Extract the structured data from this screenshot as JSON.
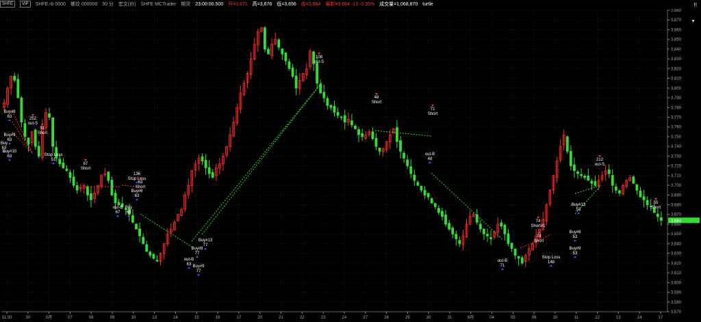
{
  "header": {
    "symbol_badge": "SHFE",
    "vip_badge": "VIP",
    "contract_code": "SHFE.rb 0000",
    "contract_name": "螺纹 000000",
    "period": "30 分",
    "chart_type": "宏文(价)",
    "exchange_text": "SHFE MCTrader",
    "date_label": "期货",
    "time_value": "23:00:00.500",
    "open_label": "开=3,671",
    "high_label": "高=3,676",
    "low_label": "低=3,656",
    "close_label": "收=3,664",
    "change_label": "最新=3,664 -13 -0.35%",
    "volume_label": "成交量=1,068,870",
    "strategy_name": "turtle",
    "right_marker": "!!",
    "right_marker2": "▼"
  },
  "colors": {
    "background": "#000000",
    "up_candle": "#ff2a2a",
    "down_candle": "#33dd33",
    "current_price_bg": "#33dd33",
    "axis_text": "#aaaaaa",
    "buy_arrow": "#3355ff",
    "sell_arrow": "#ff3333",
    "trade_line_win": "#33dd33",
    "trade_line_loss": "#ff3333"
  },
  "current_price": "3,664",
  "chart_data": {
    "type": "candlestick",
    "ylim": [
      3570,
      3880
    ],
    "y_ticks": [
      "3,880",
      "3,870",
      "3,860",
      "3,850",
      "3,840",
      "3,830",
      "3,820",
      "3,810",
      "3,800",
      "3,790",
      "3,780",
      "3,770",
      "3,760",
      "3,750",
      "3,740",
      "3,730",
      "3,720",
      "3,710",
      "3,700",
      "3,690",
      "3,680",
      "3,670",
      "3,660",
      "3,650",
      "3,640",
      "3,630",
      "3,620",
      "3,610",
      "3,600",
      "3,590",
      "3,580",
      "3,570"
    ],
    "x_ticks": [
      "11:00",
      "30",
      "5月",
      "07",
      "08",
      "09",
      "10",
      "13",
      "14",
      "15",
      "16",
      "17",
      "20",
      "21",
      "22",
      "23",
      "24",
      "27",
      "28",
      "29",
      "30",
      "31",
      "6月",
      "04",
      "05",
      "06",
      "10",
      "11",
      "12",
      "13",
      "14",
      "17"
    ],
    "close_path": [
      3785,
      3800,
      3812,
      3808,
      3790,
      3765,
      3750,
      3742,
      3755,
      3740,
      3730,
      3760,
      3775,
      3770,
      3740,
      3728,
      3722,
      3718,
      3715,
      3708,
      3700,
      3695,
      3698,
      3700,
      3690,
      3685,
      3692,
      3700,
      3710,
      3712,
      3705,
      3690,
      3682,
      3680,
      3678,
      3675,
      3670,
      3662,
      3655,
      3648,
      3640,
      3632,
      3628,
      3625,
      3622,
      3630,
      3640,
      3650,
      3655,
      3662,
      3670,
      3675,
      3690,
      3700,
      3715,
      3722,
      3728,
      3725,
      3718,
      3712,
      3708,
      3718,
      3722,
      3730,
      3740,
      3752,
      3765,
      3780,
      3795,
      3805,
      3815,
      3830,
      3845,
      3858,
      3862,
      3840,
      3835,
      3845,
      3850,
      3842,
      3835,
      3828,
      3820,
      3812,
      3800,
      3808,
      3815,
      3820,
      3838,
      3825,
      3805,
      3795,
      3790,
      3782,
      3780,
      3775,
      3772,
      3770,
      3765,
      3768,
      3762,
      3758,
      3752,
      3750,
      3752,
      3755,
      3748,
      3740,
      3735,
      3738,
      3745,
      3752,
      3758,
      3745,
      3735,
      3728,
      3720,
      3712,
      3705,
      3700,
      3695,
      3690,
      3688,
      3682,
      3678,
      3672,
      3668,
      3660,
      3655,
      3650,
      3645,
      3640,
      3648,
      3660,
      3668,
      3670,
      3662,
      3655,
      3650,
      3648,
      3645,
      3652,
      3660,
      3658,
      3650,
      3640,
      3635,
      3628,
      3625,
      3620,
      3628,
      3635,
      3640,
      3648,
      3655,
      3665,
      3680,
      3695,
      3710,
      3725,
      3740,
      3752,
      3735,
      3720,
      3715,
      3712,
      3710,
      3708,
      3705,
      3702,
      3700,
      3705,
      3710,
      3715,
      3712,
      3700,
      3695,
      3692,
      3700,
      3705,
      3708,
      3702,
      3695,
      3688,
      3685,
      3680,
      3678,
      3672,
      3668,
      3664
    ],
    "markers": [
      {
        "text": "Buy#8",
        "sub": "63",
        "kind": "buy"
      },
      {
        "text": "252",
        "sub": "out-S",
        "kind": "sell"
      },
      {
        "text": "Buy#9",
        "sub": "63",
        "kind": "buy"
      },
      {
        "text": "Buy",
        "sub": "63",
        "kind": "buy"
      },
      {
        "text": "Buy#10",
        "sub": "63",
        "kind": "buy"
      },
      {
        "text": "51",
        "sub": "Short",
        "kind": "sell"
      },
      {
        "text": "Stop Loss",
        "sub": "51",
        "kind": "buy"
      },
      {
        "text": "67",
        "sub": "Short",
        "kind": "sell"
      },
      {
        "text": "136",
        "sub": "Stop Loss",
        "kind": "buy"
      },
      {
        "text": "63",
        "sub": "Short",
        "kind": "sell"
      },
      {
        "text": "Buy#8",
        "sub": "63",
        "kind": "buy"
      },
      {
        "text": "out-B",
        "sub": "67",
        "kind": "buy"
      },
      {
        "text": "Buy",
        "sub": "68",
        "kind": "buy"
      },
      {
        "text": "Buy#13",
        "sub": "77",
        "kind": "buy"
      },
      {
        "text": "Buy#8",
        "sub": "77",
        "kind": "buy"
      },
      {
        "text": "out-B",
        "sub": "63",
        "kind": "buy"
      },
      {
        "text": "Buy#9",
        "sub": "77",
        "kind": "buy"
      },
      {
        "text": "108",
        "sub": "out-S",
        "kind": "sell"
      },
      {
        "text": "48",
        "sub": "Short",
        "kind": "sell"
      },
      {
        "text": "71",
        "sub": "Short",
        "kind": "sell"
      },
      {
        "text": "out-B",
        "sub": "48",
        "kind": "buy"
      },
      {
        "text": "out-B",
        "sub": "71",
        "kind": "buy"
      },
      {
        "text": "74",
        "sub": "Short#1",
        "kind": "sell"
      },
      {
        "text": "74",
        "sub": "Short",
        "kind": "sell"
      },
      {
        "text": "Stop Loss",
        "sub": "148",
        "kind": "buy"
      },
      {
        "text": "Buy#13",
        "sub": "53",
        "kind": "buy"
      },
      {
        "text": "Buy#8",
        "sub": "53",
        "kind": "buy"
      },
      {
        "text": "Buy#9",
        "sub": "53",
        "kind": "buy"
      },
      {
        "text": "212",
        "sub": "out-S",
        "kind": "sell"
      },
      {
        "text": "55",
        "sub": "Short",
        "kind": "sell"
      }
    ]
  }
}
